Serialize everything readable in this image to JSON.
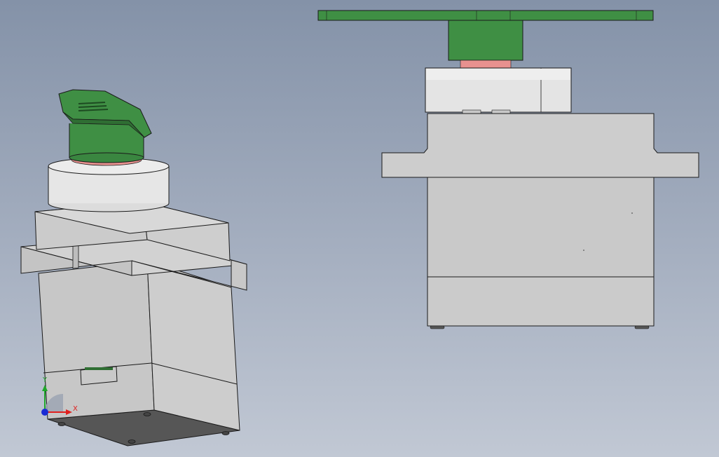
{
  "app": {
    "viewport_label": ""
  },
  "views": [
    {
      "name": "isometric-view"
    },
    {
      "name": "front-view"
    }
  ],
  "triad": {
    "x_label": "X",
    "y_label": "Y",
    "x_color": "#e0201e",
    "y_color": "#1fa82a",
    "z_color": "#1a2bd4"
  },
  "colors": {
    "background_top": "#8492a8",
    "background_bottom": "#c1c8d4",
    "servo_body": "#cacaca",
    "servo_body_shade": "#b8b8b8",
    "servo_bottom": "#565656",
    "horn_green": "#3f8f44",
    "horn_green_dark": "#2f6e33",
    "shaft_pink": "#e8918f",
    "bearing_white": "#e6e6e6",
    "edge": "#1a1a1a"
  }
}
